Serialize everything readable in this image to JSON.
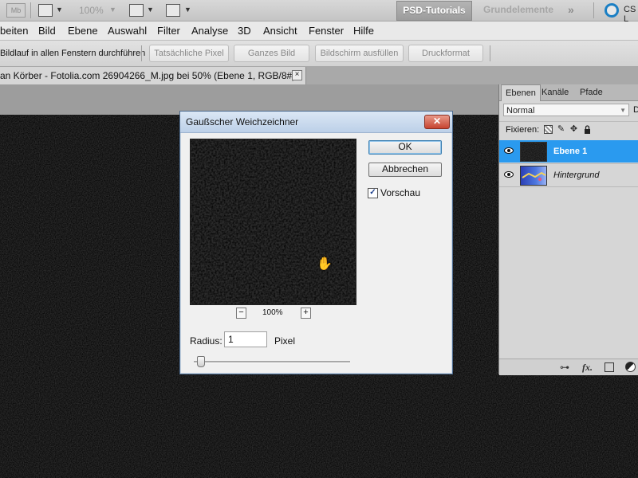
{
  "appbar": {
    "mb_label": "Mb",
    "zoom": "100%",
    "workspaces": {
      "active": "PSD-Tutorials",
      "normal": "Grundelemente",
      "more": "»"
    },
    "cs_label": "CS L"
  },
  "menu": [
    "beiten",
    "Bild",
    "Ebene",
    "Auswahl",
    "Filter",
    "Analyse",
    "3D",
    "Ansicht",
    "Fenster",
    "Hilfe"
  ],
  "options": {
    "scroll_all": "Bildlauf in allen Fenstern durchführen",
    "buttons": [
      "Tatsächliche Pixel",
      "Ganzes Bild",
      "Bildschirm ausfüllen",
      "Druckformat"
    ]
  },
  "document": {
    "tab_title": "an Körber - Fotolia.com 26904266_M.jpg bei 50% (Ebene 1, RGB/8#) *",
    "close": "×"
  },
  "layers_panel": {
    "tabs": [
      "Ebenen",
      "Kanäle",
      "Pfade"
    ],
    "blend_mode": "Normal",
    "opacity_label": "D",
    "fix_label": "Fixieren:",
    "layers": [
      {
        "name": "Ebene 1",
        "selected": true
      },
      {
        "name": "Hintergrund",
        "selected": false
      }
    ],
    "bottom_icons": [
      "link-icon",
      "fx-icon",
      "mask-icon",
      "adjustment-icon"
    ]
  },
  "dialog": {
    "title": "Gaußscher Weichzeichner",
    "close": "✕",
    "ok": "OK",
    "cancel": "Abbrechen",
    "preview_label": "Vorschau",
    "preview_checked": true,
    "zoom_minus": "−",
    "zoom_plus": "+",
    "zoom": "100%",
    "radius_label": "Radius:",
    "radius_value": "1",
    "radius_unit": "Pixel",
    "radius_fraction": 0.04
  },
  "colors": {
    "selected_layer": "#2a9aef",
    "dialog_title": "#bcd0e8",
    "close_red": "#c74431"
  }
}
